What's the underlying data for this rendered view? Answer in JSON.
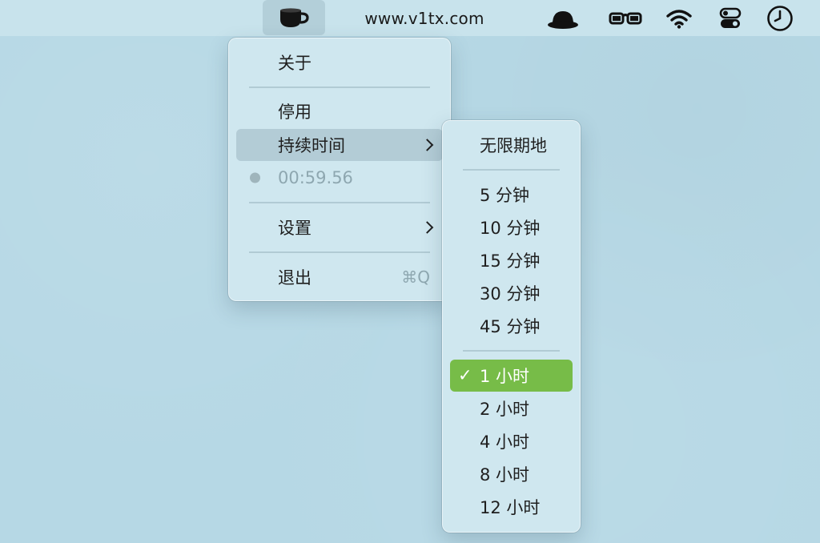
{
  "menubar": {
    "site": "www.v1tx.com",
    "icons": [
      "coffee-cup-icon",
      "hat-icon",
      "glasses-icon",
      "wifi-icon",
      "control-center-icon",
      "clock-icon"
    ]
  },
  "main_menu": {
    "about": "关于",
    "disable": "停用",
    "duration": "持续时间",
    "remaining": "00:59.56",
    "settings": "设置",
    "quit": "退出",
    "quit_shortcut": "⌘Q"
  },
  "duration_menu": {
    "items": [
      "无限期地",
      "5 分钟",
      "10 分钟",
      "15 分钟",
      "30 分钟",
      "45 分钟",
      "1 小时",
      "2 小时",
      "4 小时",
      "8 小时",
      "12 小时"
    ],
    "selected": "1 小时",
    "check_mark": "✓"
  },
  "colors": {
    "selection_green": "#77bc48",
    "hover_gray": "#b3ccd6",
    "background": "#b6d8e5"
  }
}
